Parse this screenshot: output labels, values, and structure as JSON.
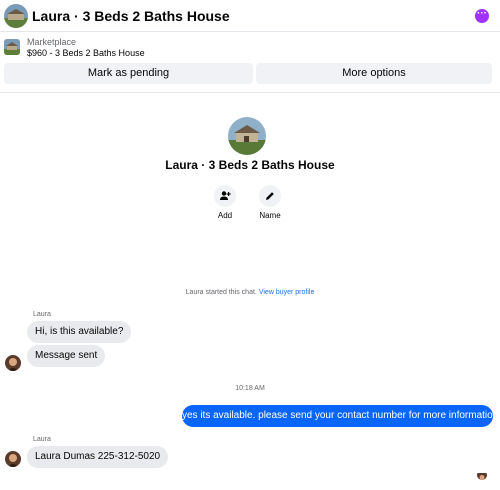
{
  "header": {
    "title": "Laura · 3 Beds 2 Baths House",
    "more_icon": "more-dots-icon"
  },
  "listing": {
    "source": "Marketplace",
    "item": "$960 - 3 Beds 2 Baths House"
  },
  "actions_bar": {
    "pending_label": "Mark as pending",
    "more_label": "More options"
  },
  "profile": {
    "name": "Laura · 3 Beds 2 Baths House",
    "actions": [
      {
        "label": "Add",
        "icon": "add-person-icon"
      },
      {
        "label": "Name",
        "icon": "pencil-icon"
      }
    ]
  },
  "system_message": {
    "text": "Laura started this chat.",
    "link": "View buyer profile"
  },
  "messages": {
    "group1_sender": "Laura",
    "group1": [
      "Hi, is this available?",
      "Message sent"
    ],
    "timestamp": "10:18 AM",
    "outgoing": "yes its available. please send your contact number for more information",
    "group2_sender": "Laura",
    "group2": [
      "Laura Dumas 225-312-5020"
    ]
  },
  "colors": {
    "accent": "#0866ff",
    "more_button": "#a033ff"
  }
}
